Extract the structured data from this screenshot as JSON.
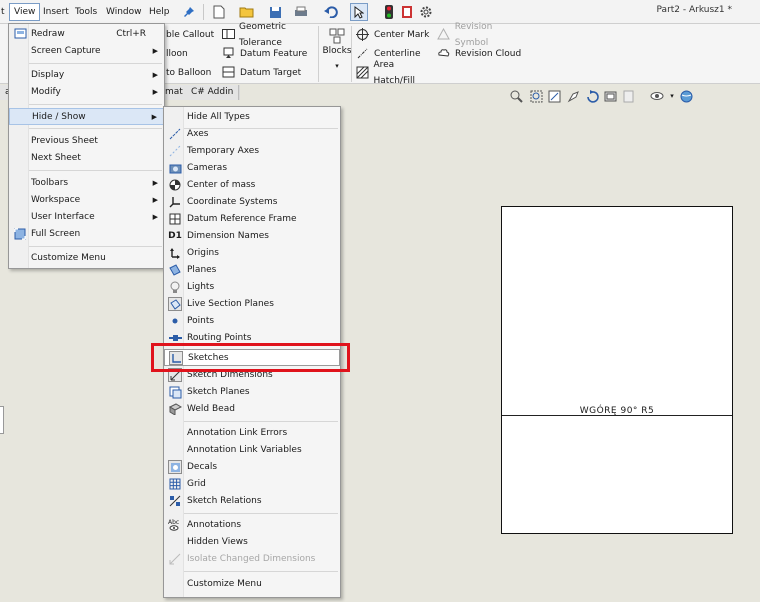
{
  "menubar": {
    "items": [
      {
        "label": "t"
      },
      {
        "label": "View"
      },
      {
        "label": "Insert"
      },
      {
        "label": "Tools"
      },
      {
        "label": "Window"
      },
      {
        "label": "Help"
      }
    ],
    "document_title": "Part2 - Arkusz1 *"
  },
  "ribbon": {
    "left_col": [
      "ble Callout",
      "lloon",
      "to Balloon"
    ],
    "annotate_col": [
      "Geometric Tolerance",
      "Datum Feature",
      "Datum Target"
    ],
    "blocks_label": "Blocks",
    "center_col": [
      "Center Mark",
      "Centerline",
      "Area Hatch/Fill"
    ],
    "revision_col": [
      "Revision Symbol",
      "Revision Cloud"
    ]
  },
  "tabs": [
    "al",
    "mat",
    "C# Addin"
  ],
  "view_menu": {
    "items": [
      {
        "label": "Redraw",
        "shortcut": "Ctrl+R",
        "icon": "redraw-icon"
      },
      {
        "label": "Screen Capture",
        "submenu": true
      },
      {
        "label": "Display",
        "submenu": true
      },
      {
        "label": "Modify",
        "submenu": true
      },
      {
        "label": "Hide / Show",
        "submenu": true,
        "highlighted": true
      },
      {
        "label": "Previous Sheet"
      },
      {
        "label": "Next Sheet"
      },
      {
        "label": "Toolbars",
        "submenu": true
      },
      {
        "label": "Workspace",
        "submenu": true
      },
      {
        "label": "User Interface",
        "submenu": true
      },
      {
        "label": "Full Screen",
        "icon": "full-screen-icon"
      },
      {
        "label": "Customize Menu"
      }
    ]
  },
  "hide_show_menu": {
    "items": [
      {
        "label": "Hide All Types"
      },
      {
        "label": "Axes",
        "icon": "axes-icon"
      },
      {
        "label": "Temporary Axes",
        "icon": "temporary-axes-icon"
      },
      {
        "label": "Cameras",
        "icon": "camera-icon"
      },
      {
        "label": "Center of mass",
        "icon": "center-of-mass-icon"
      },
      {
        "label": "Coordinate Systems",
        "icon": "coordinate-system-icon"
      },
      {
        "label": "Datum Reference Frame",
        "icon": "datum-reference-frame-icon"
      },
      {
        "label": "Dimension Names",
        "icon": "dimension-names-icon"
      },
      {
        "label": "Origins",
        "icon": "origin-icon"
      },
      {
        "label": "Planes",
        "icon": "plane-icon"
      },
      {
        "label": "Lights",
        "icon": "light-bulb-icon"
      },
      {
        "label": "Live Section Planes",
        "icon": "live-section-plane-icon"
      },
      {
        "label": "Points",
        "icon": "point-icon"
      },
      {
        "label": "Routing Points",
        "icon": "routing-point-icon"
      },
      {
        "label": "Sketches",
        "icon": "sketch-icon",
        "highlighted": true
      },
      {
        "label": "Sketch Dimensions",
        "icon": "sketch-dimension-icon"
      },
      {
        "label": "Sketch Planes",
        "icon": "sketch-plane-icon"
      },
      {
        "label": "Weld Bead",
        "icon": "weld-bead-icon"
      },
      {
        "label": "Annotation Link Errors"
      },
      {
        "label": "Annotation Link Variables"
      },
      {
        "label": "Decals",
        "icon": "decal-icon"
      },
      {
        "label": "Grid",
        "icon": "grid-icon"
      },
      {
        "label": "Sketch Relations",
        "icon": "sketch-relations-icon"
      },
      {
        "label": "Annotations",
        "icon": "annotations-icon"
      },
      {
        "label": "Hidden Views"
      },
      {
        "label": "Isolate Changed Dimensions",
        "disabled": true,
        "icon": "isolate-dimensions-icon"
      },
      {
        "label": "Customize Menu"
      }
    ]
  },
  "drawing": {
    "sheet_label": "WGÓRĘ 90° R5"
  },
  "colors": {
    "highlight_box": "#e0131c",
    "menu_highlight": "#dbe7f6",
    "canvas": "#e7e6dd"
  }
}
